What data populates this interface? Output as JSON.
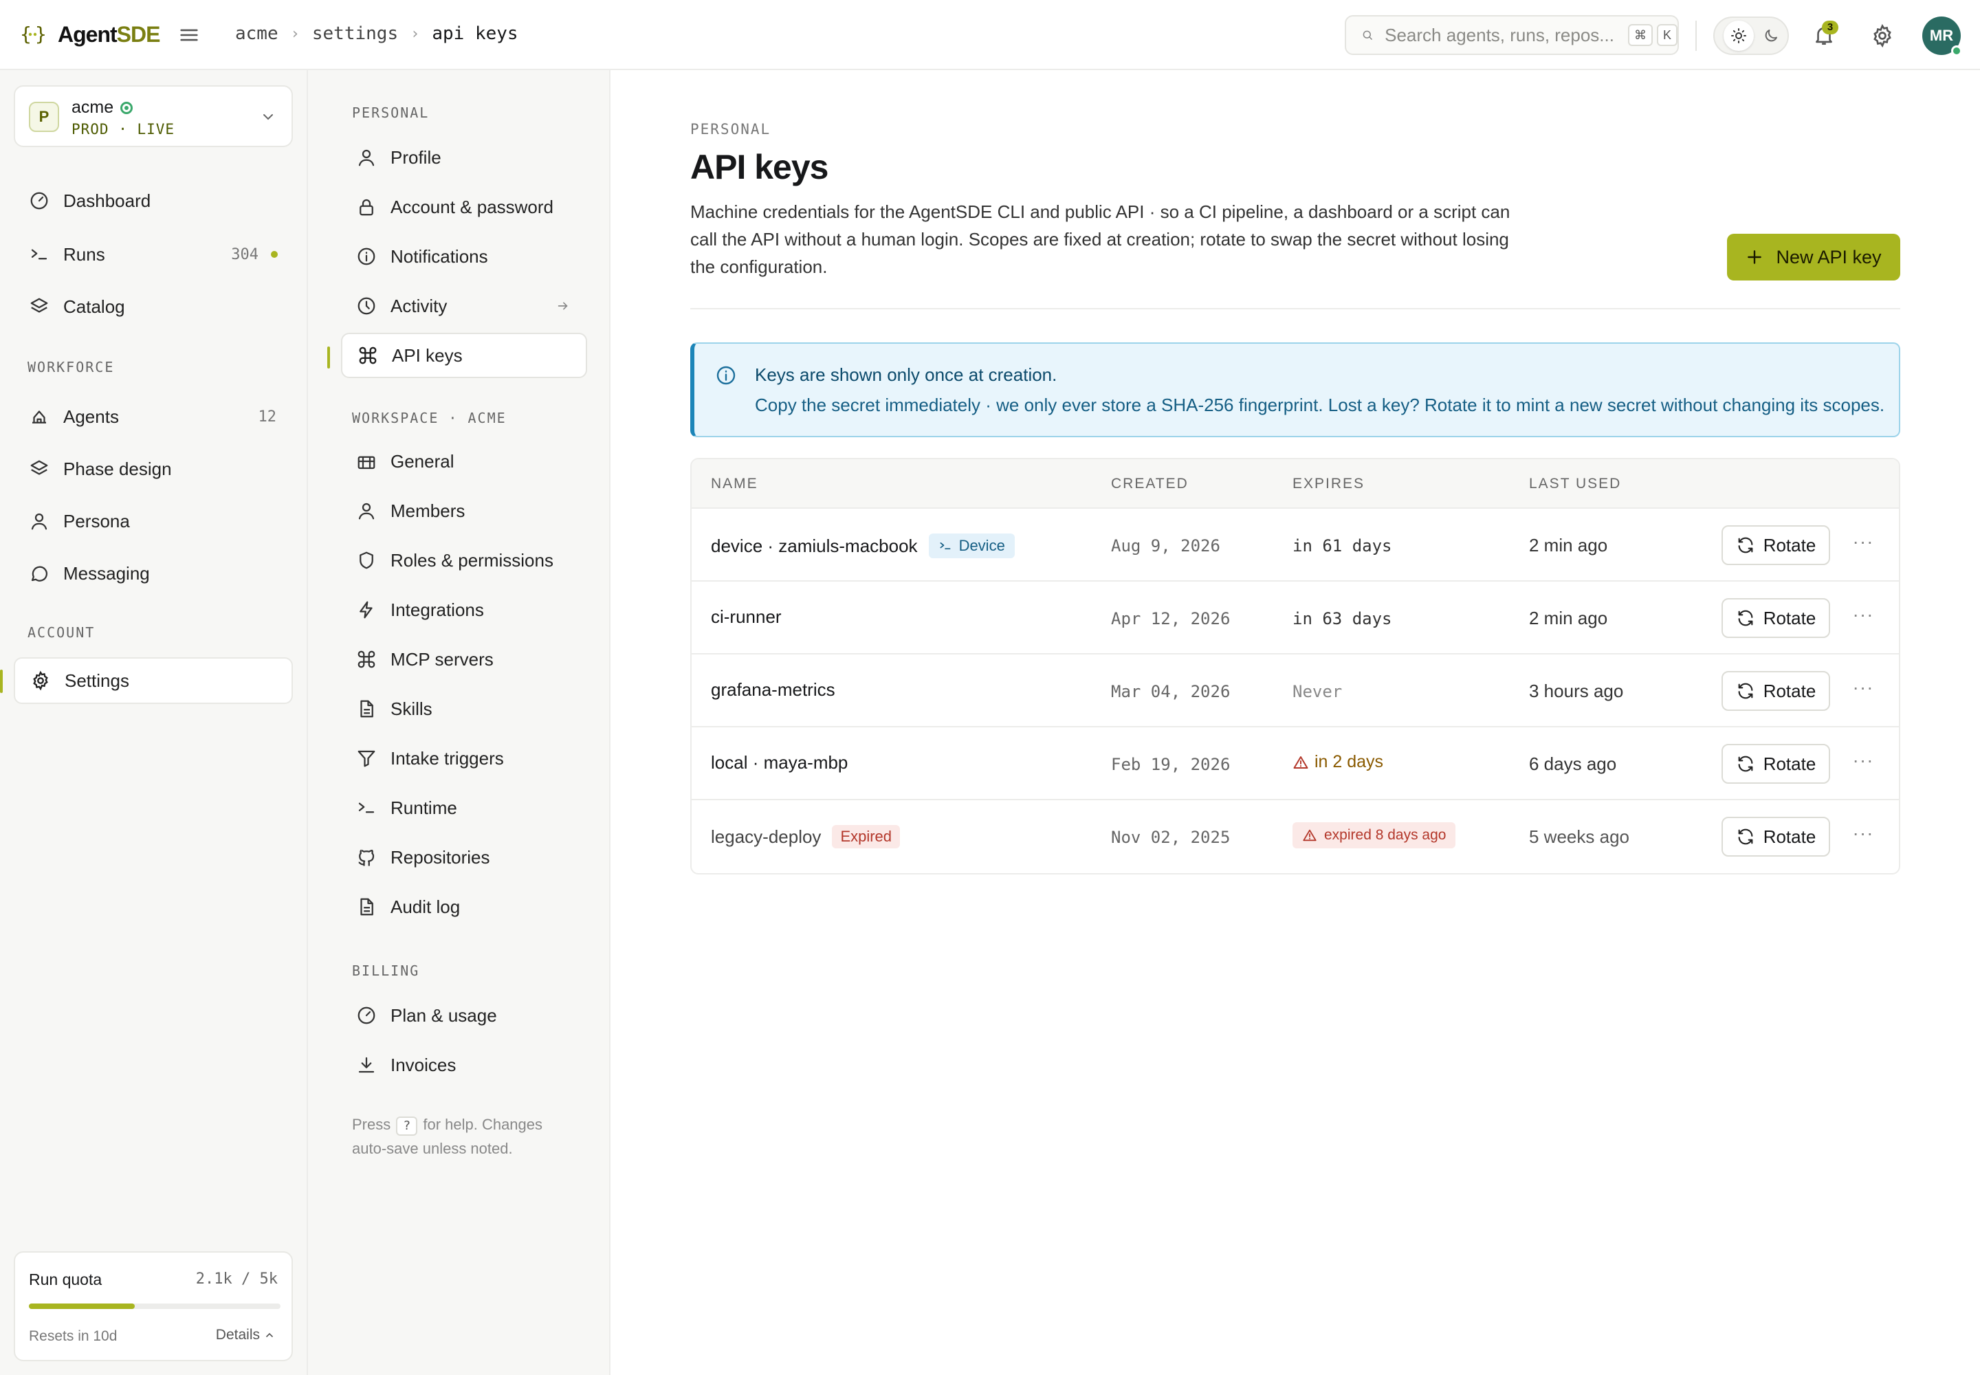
{
  "app": {
    "brand_a": "Agent",
    "brand_b": "SDE"
  },
  "breadcrumbs": [
    "acme",
    "settings",
    "api keys"
  ],
  "search": {
    "placeholder": "Search agents, runs, repos...",
    "kbd1": "⌘",
    "kbd2": "K"
  },
  "notifications": {
    "count": "3"
  },
  "user": {
    "initials": "MR"
  },
  "workspace": {
    "initial": "P",
    "name": "acme",
    "env": "PROD · LIVE"
  },
  "nav": {
    "main": [
      {
        "label": "Dashboard",
        "icon": "dashboard-icon"
      },
      {
        "label": "Runs",
        "icon": "terminal-icon",
        "count": "304"
      },
      {
        "label": "Catalog",
        "icon": "layers-icon"
      }
    ],
    "workforce_label": "WORKFORCE",
    "workforce": [
      {
        "label": "Agents",
        "icon": "agents-icon",
        "count": "12"
      },
      {
        "label": "Phase design",
        "icon": "layers-icon"
      },
      {
        "label": "Persona",
        "icon": "person-icon"
      },
      {
        "label": "Messaging",
        "icon": "chat-icon"
      }
    ],
    "account_label": "ACCOUNT",
    "account": [
      {
        "label": "Settings",
        "icon": "gear-icon"
      }
    ]
  },
  "quota": {
    "title": "Run quota",
    "value": "2.1k / 5k",
    "fraction": 0.42,
    "resets": "Resets in 10d",
    "details": "Details"
  },
  "settings_nav": {
    "personal_label": "PERSONAL",
    "personal": [
      {
        "label": "Profile",
        "icon": "person-icon"
      },
      {
        "label": "Account & password",
        "icon": "lock-icon"
      },
      {
        "label": "Notifications",
        "icon": "info-icon"
      },
      {
        "label": "Activity",
        "icon": "clock-icon"
      },
      {
        "label": "API keys",
        "icon": "command-icon"
      }
    ],
    "workspace_label": "WORKSPACE · ACME",
    "workspace": [
      {
        "label": "General",
        "icon": "building-icon"
      },
      {
        "label": "Members",
        "icon": "person-icon"
      },
      {
        "label": "Roles & permissions",
        "icon": "shield-icon"
      },
      {
        "label": "Integrations",
        "icon": "bolt-icon"
      },
      {
        "label": "MCP servers",
        "icon": "command-icon"
      },
      {
        "label": "Skills",
        "icon": "document-icon"
      },
      {
        "label": "Intake triggers",
        "icon": "filter-icon"
      },
      {
        "label": "Runtime",
        "icon": "terminal-icon"
      },
      {
        "label": "Repositories",
        "icon": "github-icon"
      },
      {
        "label": "Audit log",
        "icon": "document-icon"
      }
    ],
    "billing_label": "BILLING",
    "billing": [
      {
        "label": "Plan & usage",
        "icon": "gauge-icon"
      },
      {
        "label": "Invoices",
        "icon": "download-icon"
      }
    ],
    "help_pre": "Press",
    "help_key": "?",
    "help_post": "for help. Changes auto-save unless noted."
  },
  "page": {
    "eyebrow": "PERSONAL",
    "title": "API keys",
    "description": "Machine credentials for the AgentSDE CLI and public API · so a CI pipeline, a dashboard or a script can call the API without a human login. Scopes are fixed at creation; rotate to swap the secret without losing the configuration.",
    "new_button": "New API key"
  },
  "info": {
    "heading": "Keys are shown only once at creation.",
    "body": "Copy the secret immediately · we only ever store a SHA-256 fingerprint. Lost a key? Rotate it to mint a new secret without changing its scopes."
  },
  "table": {
    "columns": [
      "NAME",
      "CREATED",
      "EXPIRES",
      "LAST USED"
    ],
    "rotate_label": "Rotate",
    "rows": [
      {
        "name": "device · zamiuls-macbook",
        "tag": "Device",
        "created": "Aug 9, 2026",
        "expires": "in 61 days",
        "last_used": "2 min ago"
      },
      {
        "name": "ci-runner",
        "created": "Apr 12, 2026",
        "expires": "in 63 days",
        "last_used": "2 min ago"
      },
      {
        "name": "grafana-metrics",
        "created": "Mar 04, 2026",
        "expires": "Never",
        "last_used": "3 hours ago"
      },
      {
        "name": "local · maya-mbp",
        "created": "Feb 19, 2026",
        "expires": "in 2 days",
        "last_used": "6 days ago"
      },
      {
        "name": "legacy-deploy",
        "tag": "Expired",
        "created": "Nov 02, 2025",
        "expires": "expired 8 days ago",
        "last_used": "5 weeks ago"
      }
    ]
  },
  "colors": {
    "accent": "#a8b520",
    "info_border": "#1c85b8",
    "danger": "#b3372a",
    "warning": "#8a5a00"
  }
}
